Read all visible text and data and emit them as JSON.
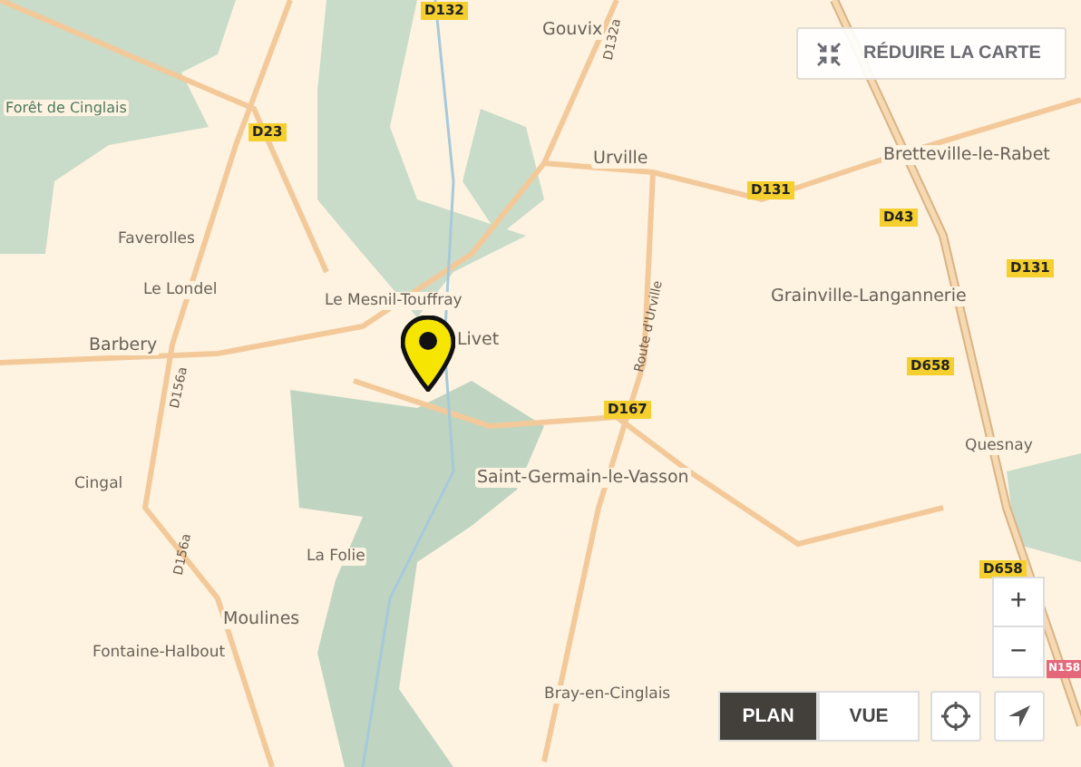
{
  "map": {
    "places": [
      {
        "name": "Forêt de Cinglais",
        "kind": "forest"
      },
      {
        "name": "Gouvix",
        "kind": "town"
      },
      {
        "name": "Urville",
        "kind": "town"
      },
      {
        "name": "Bretteville-le-Rabet",
        "kind": "town"
      },
      {
        "name": "Faverolles",
        "kind": "village"
      },
      {
        "name": "Le Londel",
        "kind": "village"
      },
      {
        "name": "Le Mesnil-Touffray",
        "kind": "village"
      },
      {
        "name": "Livet",
        "kind": "town"
      },
      {
        "name": "Barbery",
        "kind": "town"
      },
      {
        "name": "Grainville-Langannerie",
        "kind": "town"
      },
      {
        "name": "Saint-Germain-le-Vasson",
        "kind": "town"
      },
      {
        "name": "Cingal",
        "kind": "village"
      },
      {
        "name": "La Folie",
        "kind": "village"
      },
      {
        "name": "Moulines",
        "kind": "town"
      },
      {
        "name": "Fontaine-Halbout",
        "kind": "village"
      },
      {
        "name": "Quesnay",
        "kind": "village"
      },
      {
        "name": "Bray-en-Cinglais",
        "kind": "village"
      }
    ],
    "roads": [
      {
        "label": "D132",
        "kind": "shield"
      },
      {
        "label": "D132a",
        "kind": "vertical"
      },
      {
        "label": "D23",
        "kind": "shield"
      },
      {
        "label": "D131",
        "kind": "shield"
      },
      {
        "label": "D43",
        "kind": "shield"
      },
      {
        "label": "D131",
        "kind": "shield"
      },
      {
        "label": "D658",
        "kind": "shield"
      },
      {
        "label": "D167",
        "kind": "shield"
      },
      {
        "label": "D658",
        "kind": "shield"
      },
      {
        "label": "N158",
        "kind": "national"
      },
      {
        "label": "D156a",
        "kind": "vertical"
      },
      {
        "label": "D156a",
        "kind": "vertical"
      },
      {
        "label": "Route d'Urville",
        "kind": "vertical"
      }
    ]
  },
  "collapse_button": {
    "label": "RÉDUIRE LA CARTE"
  },
  "view_toggle": [
    {
      "label": "PLAN",
      "selected": true
    },
    {
      "label": "VUE",
      "selected": false
    }
  ],
  "zoom": {
    "in": "+",
    "out": "−"
  }
}
